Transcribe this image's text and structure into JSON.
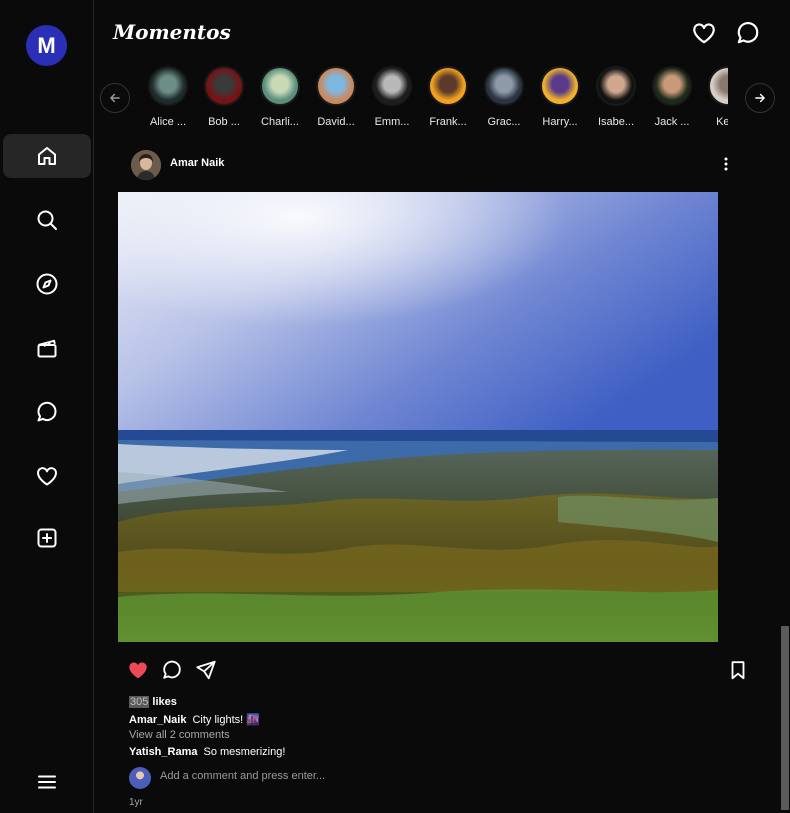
{
  "app": {
    "brand": "Momentos",
    "avatar_letter": "M"
  },
  "sidebar": {
    "items": [
      {
        "name": "home",
        "active": true
      },
      {
        "name": "search"
      },
      {
        "name": "explore"
      },
      {
        "name": "reels"
      },
      {
        "name": "messages"
      },
      {
        "name": "notifications"
      },
      {
        "name": "create"
      }
    ],
    "menu": "more"
  },
  "stories": [
    {
      "label": "Alice ...",
      "colors": [
        "#1e2b2a",
        "#6e8f86"
      ]
    },
    {
      "label": "Bob ...",
      "colors": [
        "#7a1212",
        "#3a3a3a"
      ]
    },
    {
      "label": "Charli...",
      "colors": [
        "#5a8f7e",
        "#c9d9b6"
      ]
    },
    {
      "label": "David...",
      "colors": [
        "#c98a5e",
        "#7fb7e0"
      ]
    },
    {
      "label": "Emm...",
      "colors": [
        "#1e1e1e",
        "#b9b9b9"
      ]
    },
    {
      "label": "Frank...",
      "colors": [
        "#f2a11f",
        "#5a3a2a"
      ]
    },
    {
      "label": "Grac...",
      "colors": [
        "#2b3440",
        "#8e9aa8"
      ]
    },
    {
      "label": "Harry...",
      "colors": [
        "#f0b12a",
        "#5a3a8a"
      ]
    },
    {
      "label": "Isabe...",
      "colors": [
        "#121212",
        "#d0a890"
      ]
    },
    {
      "label": "Jack ...",
      "colors": [
        "#1d2a1a",
        "#c99a7a"
      ]
    },
    {
      "label": "Kelly",
      "colors": [
        "#d8d0c8",
        "#8a7a6e"
      ]
    }
  ],
  "post": {
    "username": "Amar Naik",
    "likes_count": "305",
    "likes_suffix": "likes",
    "caption_user": "Amar_Naik",
    "caption_text": "City lights! 🌆",
    "view_all": "View all 2 comments",
    "comment_user": "Yatish_Rama",
    "comment_text": "So mesmerizing!",
    "comment_placeholder": "Add a comment and press enter...",
    "time": "1yr",
    "liked": true
  },
  "colors": {
    "like": "#ed4956",
    "background": "#0a0a0a",
    "sidebar_active": "#262626"
  }
}
